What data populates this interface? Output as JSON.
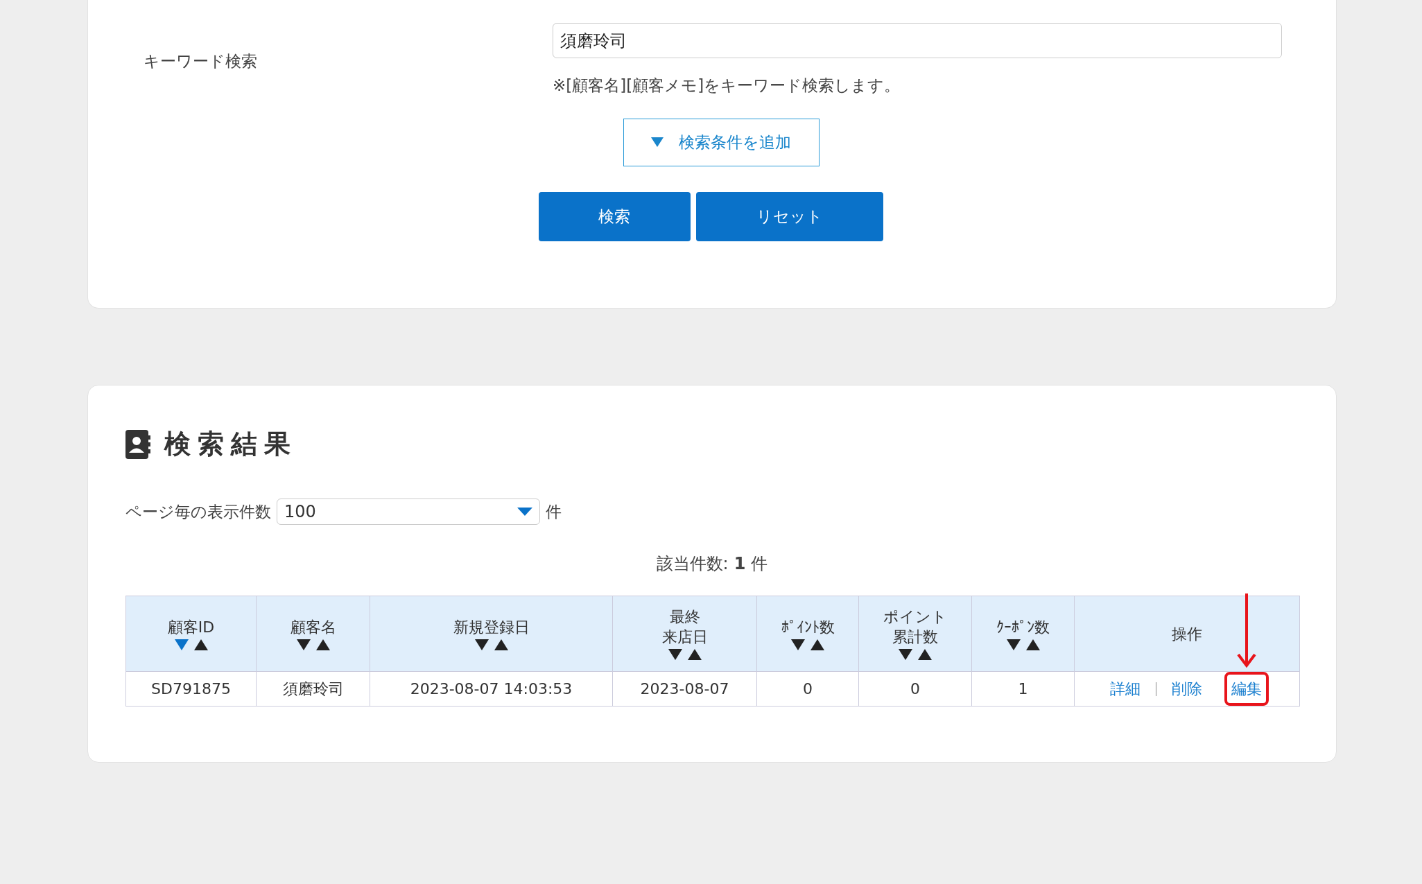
{
  "search_form": {
    "keyword_label": "キーワード検索",
    "keyword_value": "須磨玲司",
    "note": "※[顧客名][顧客メモ]をキーワード検索します。",
    "add_condition_button": "検索条件を追加",
    "buttons": [
      "検索",
      "リセット"
    ]
  },
  "results": {
    "title": "検索結果",
    "page_size_label": "ページ毎の表示件数",
    "page_size_value": "100",
    "page_size_unit": "件",
    "count_label": "該当件数:",
    "count_value": "1",
    "count_unit": "件",
    "table": {
      "columns": [
        {
          "lines": [
            "顧客ID"
          ],
          "kind": "sortable",
          "desc_selected": true
        },
        {
          "lines": [
            "顧客名"
          ],
          "kind": "sortable",
          "desc_selected": false
        },
        {
          "lines": [
            "新規登録日"
          ],
          "kind": "sortable",
          "desc_selected": false
        },
        {
          "lines": [
            "最終",
            "来店日"
          ],
          "kind": "sortable",
          "desc_selected": false
        },
        {
          "lines": [
            "ﾎﾟｲﾝﾄ数"
          ],
          "kind": "sortable",
          "desc_selected": false
        },
        {
          "lines": [
            "ポイント",
            "累計数"
          ],
          "kind": "sortable",
          "desc_selected": false
        },
        {
          "lines": [
            "ｸｰﾎﾟﾝ数"
          ],
          "kind": "sortable",
          "desc_selected": false
        },
        {
          "lines": [
            "操作"
          ],
          "kind": "plain"
        }
      ],
      "rows": [
        {
          "cells": [
            "SD791875",
            "須磨玲司",
            "2023-08-07 14:03:53",
            "2023-08-07",
            "0",
            "0",
            "1"
          ],
          "actions": [
            {
              "label": "詳細",
              "highlighted": false
            },
            {
              "label": "削除",
              "highlighted": false
            },
            {
              "label": "編集",
              "highlighted": true
            }
          ]
        }
      ]
    }
  }
}
